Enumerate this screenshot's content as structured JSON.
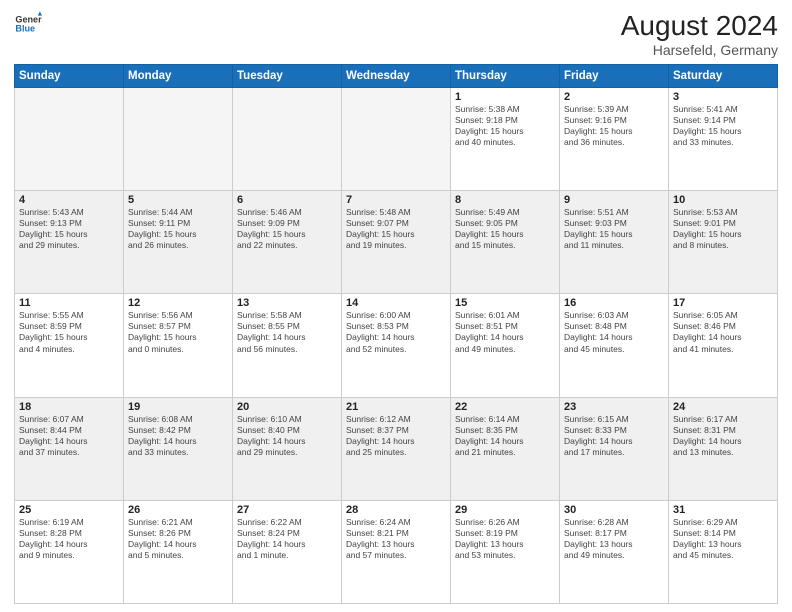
{
  "logo": {
    "general": "General",
    "blue": "Blue"
  },
  "header": {
    "month_year": "August 2024",
    "location": "Harsefeld, Germany"
  },
  "days_of_week": [
    "Sunday",
    "Monday",
    "Tuesday",
    "Wednesday",
    "Thursday",
    "Friday",
    "Saturday"
  ],
  "weeks": [
    [
      {
        "day": "",
        "info": ""
      },
      {
        "day": "",
        "info": ""
      },
      {
        "day": "",
        "info": ""
      },
      {
        "day": "",
        "info": ""
      },
      {
        "day": "1",
        "info": "Sunrise: 5:38 AM\nSunset: 9:18 PM\nDaylight: 15 hours\nand 40 minutes."
      },
      {
        "day": "2",
        "info": "Sunrise: 5:39 AM\nSunset: 9:16 PM\nDaylight: 15 hours\nand 36 minutes."
      },
      {
        "day": "3",
        "info": "Sunrise: 5:41 AM\nSunset: 9:14 PM\nDaylight: 15 hours\nand 33 minutes."
      }
    ],
    [
      {
        "day": "4",
        "info": "Sunrise: 5:43 AM\nSunset: 9:13 PM\nDaylight: 15 hours\nand 29 minutes."
      },
      {
        "day": "5",
        "info": "Sunrise: 5:44 AM\nSunset: 9:11 PM\nDaylight: 15 hours\nand 26 minutes."
      },
      {
        "day": "6",
        "info": "Sunrise: 5:46 AM\nSunset: 9:09 PM\nDaylight: 15 hours\nand 22 minutes."
      },
      {
        "day": "7",
        "info": "Sunrise: 5:48 AM\nSunset: 9:07 PM\nDaylight: 15 hours\nand 19 minutes."
      },
      {
        "day": "8",
        "info": "Sunrise: 5:49 AM\nSunset: 9:05 PM\nDaylight: 15 hours\nand 15 minutes."
      },
      {
        "day": "9",
        "info": "Sunrise: 5:51 AM\nSunset: 9:03 PM\nDaylight: 15 hours\nand 11 minutes."
      },
      {
        "day": "10",
        "info": "Sunrise: 5:53 AM\nSunset: 9:01 PM\nDaylight: 15 hours\nand 8 minutes."
      }
    ],
    [
      {
        "day": "11",
        "info": "Sunrise: 5:55 AM\nSunset: 8:59 PM\nDaylight: 15 hours\nand 4 minutes."
      },
      {
        "day": "12",
        "info": "Sunrise: 5:56 AM\nSunset: 8:57 PM\nDaylight: 15 hours\nand 0 minutes."
      },
      {
        "day": "13",
        "info": "Sunrise: 5:58 AM\nSunset: 8:55 PM\nDaylight: 14 hours\nand 56 minutes."
      },
      {
        "day": "14",
        "info": "Sunrise: 6:00 AM\nSunset: 8:53 PM\nDaylight: 14 hours\nand 52 minutes."
      },
      {
        "day": "15",
        "info": "Sunrise: 6:01 AM\nSunset: 8:51 PM\nDaylight: 14 hours\nand 49 minutes."
      },
      {
        "day": "16",
        "info": "Sunrise: 6:03 AM\nSunset: 8:48 PM\nDaylight: 14 hours\nand 45 minutes."
      },
      {
        "day": "17",
        "info": "Sunrise: 6:05 AM\nSunset: 8:46 PM\nDaylight: 14 hours\nand 41 minutes."
      }
    ],
    [
      {
        "day": "18",
        "info": "Sunrise: 6:07 AM\nSunset: 8:44 PM\nDaylight: 14 hours\nand 37 minutes."
      },
      {
        "day": "19",
        "info": "Sunrise: 6:08 AM\nSunset: 8:42 PM\nDaylight: 14 hours\nand 33 minutes."
      },
      {
        "day": "20",
        "info": "Sunrise: 6:10 AM\nSunset: 8:40 PM\nDaylight: 14 hours\nand 29 minutes."
      },
      {
        "day": "21",
        "info": "Sunrise: 6:12 AM\nSunset: 8:37 PM\nDaylight: 14 hours\nand 25 minutes."
      },
      {
        "day": "22",
        "info": "Sunrise: 6:14 AM\nSunset: 8:35 PM\nDaylight: 14 hours\nand 21 minutes."
      },
      {
        "day": "23",
        "info": "Sunrise: 6:15 AM\nSunset: 8:33 PM\nDaylight: 14 hours\nand 17 minutes."
      },
      {
        "day": "24",
        "info": "Sunrise: 6:17 AM\nSunset: 8:31 PM\nDaylight: 14 hours\nand 13 minutes."
      }
    ],
    [
      {
        "day": "25",
        "info": "Sunrise: 6:19 AM\nSunset: 8:28 PM\nDaylight: 14 hours\nand 9 minutes."
      },
      {
        "day": "26",
        "info": "Sunrise: 6:21 AM\nSunset: 8:26 PM\nDaylight: 14 hours\nand 5 minutes."
      },
      {
        "day": "27",
        "info": "Sunrise: 6:22 AM\nSunset: 8:24 PM\nDaylight: 14 hours\nand 1 minute."
      },
      {
        "day": "28",
        "info": "Sunrise: 6:24 AM\nSunset: 8:21 PM\nDaylight: 13 hours\nand 57 minutes."
      },
      {
        "day": "29",
        "info": "Sunrise: 6:26 AM\nSunset: 8:19 PM\nDaylight: 13 hours\nand 53 minutes."
      },
      {
        "day": "30",
        "info": "Sunrise: 6:28 AM\nSunset: 8:17 PM\nDaylight: 13 hours\nand 49 minutes."
      },
      {
        "day": "31",
        "info": "Sunrise: 6:29 AM\nSunset: 8:14 PM\nDaylight: 13 hours\nand 45 minutes."
      }
    ]
  ]
}
